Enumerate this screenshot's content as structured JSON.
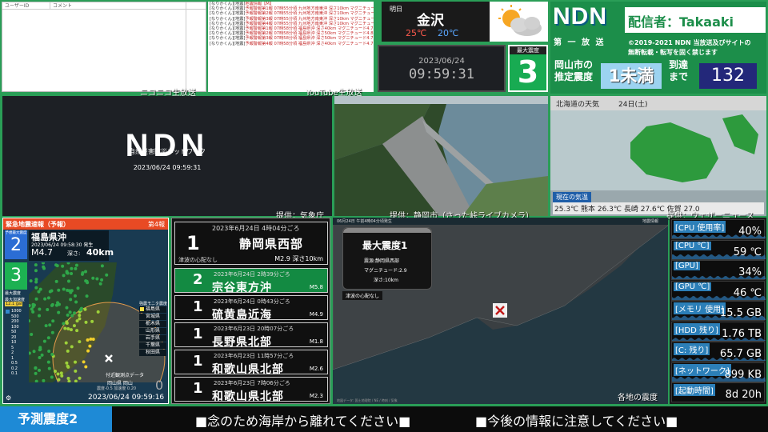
{
  "comments": {
    "col_user": "ユーザーID",
    "col_comment": "コメント"
  },
  "log": [
    [
      "[なりかくん][地震]",
      "地震情報【M】"
    ],
    [
      "[なりかくん][地震]",
      "予報警報第1報 07時55分頃 九州地方南東沖 深さ10km マグニチュード3.5 予想最大震度1"
    ],
    [
      "[なりかくん][地震]",
      "予報警報第2報 07時55分頃 九州地方南東沖 深さ10km マグニチュード3.5 予想震度1"
    ],
    [
      "[なりかくん][地震]",
      "予報警報第3報 07時55分頃 九州地方南東沖 深さ10km マグニチュード3.5 予想最大震度1"
    ],
    [
      "[なりかくん][地震]",
      "予報警報第4報 07時55分頃 九州地方南東沖 深さ10km マグニチュード3.5 予想震度1"
    ],
    [
      "[なりかくん][地震]",
      "予報警報第1報 07時58分頃 福島県沖 深さ40km マグニチュード4.7 予想最大震度2"
    ],
    [
      "[なりかくん][地震]",
      "予報警報第2報 07時58分頃 福島県沖 深さ50km マグニチュード4.8 予想最大震度2"
    ],
    [
      "[なりかくん][地震]",
      "予報警報第3報 07時58分頃 福島県沖 深さ50km マグニチュード4.7 予想最大震度2"
    ],
    [
      "[なりかくん][地震]",
      "予報警報第4報 07時58分頃 福島県沖 深さ40km マグニチュード4.7 予想最大震度2"
    ]
  ],
  "stream_labels": {
    "niconico": "ニコニコ生放送",
    "youtube": "YouTube生放送"
  },
  "weather": {
    "day": "明日",
    "city": "金沢",
    "high": "25℃",
    "low": "20℃"
  },
  "clock": {
    "date": "2023/06/24",
    "time": "09:59:31"
  },
  "max_int": {
    "label": "最大震度",
    "value": "3"
  },
  "ndn": {
    "logo": "NDN",
    "broadcaster": "配信者：Takaaki",
    "sub": "第 一 放 送",
    "copyright": "©2019-2021 NDN 当放送及びサイトの",
    "copyright2": "無断転載・転写を固く禁じます",
    "estimate_label": "岡山市の",
    "estimate_label2": "推定震度",
    "estimate_value": "1未満",
    "arrival_label": "到達",
    "arrival_label2": "まで",
    "arrival_value": "132"
  },
  "tele": {
    "logo": "NDN",
    "subtitle": "自然災害防災ネットワーク",
    "time": "2023/06/24 09:59:31"
  },
  "credits": {
    "jma": "提供：気象庁",
    "cam": "提供：静岡市（さった峠ライブカメラ）",
    "wn": "提供：ウェザーニュース"
  },
  "wmap": {
    "title": "北海道の天気",
    "date": "24日(土)",
    "current": "現在の気温",
    "temps": "25.3℃   熊本 26.3℃   長崎 27.6℃   佐賀 27.0"
  },
  "eew": {
    "header": "緊急地震速報（予報）",
    "report": "第4報",
    "pred_label": "予想最大震度",
    "pred_value": "2",
    "region": "福島県沖",
    "origin": "2023/06/24 09:58:30 発生",
    "mag": "M4.7",
    "depth_label": "深さ:",
    "depth": "40km",
    "obs_label": "最大震度",
    "obs_value": "3",
    "pga_label": "最大加速度",
    "pga_value": "12.1 gal",
    "stations": [
      "福島県",
      "宮城県",
      "栃木県",
      "山形県",
      "岩手県",
      "千葉県",
      "秋田県"
    ],
    "monitor_label": "強震モニタ震度",
    "near_label": "付近観測点データ",
    "near_name": "岡山県 岡山",
    "near_value": "震度-0.5 加速度 0.20",
    "near_int": "0",
    "time": "2023/06/24 09:59:16",
    "scale": [
      "1000",
      "500",
      "200",
      "100",
      "50",
      "20",
      "10",
      "5",
      "2",
      "1",
      "0.5",
      "0.2",
      "0.1"
    ]
  },
  "eqlist": [
    {
      "date": "2023年6月24日 4時04分ごろ",
      "int": "1",
      "loc": "静岡県西部",
      "mag": "M2.9 深さ10km",
      "note": "津波の心配なし"
    },
    {
      "date": "2023年6月24日 2時39分ごろ",
      "int": "2",
      "loc": "宗谷東方沖",
      "mag": "M5.8"
    },
    {
      "date": "2023年6月24日 0時43分ごろ",
      "int": "1",
      "loc": "硫黄島近海",
      "mag": "M4.9"
    },
    {
      "date": "2023年6月23日 20時07分ごろ",
      "int": "1",
      "loc": "長野県北部",
      "mag": "M1.8"
    },
    {
      "date": "2023年6月23日 11時57分ごろ",
      "int": "1",
      "loc": "和歌山県北部",
      "mag": "M2.6"
    },
    {
      "date": "2023年6月23日 7時06分ごろ",
      "int": "1",
      "loc": "和歌山県北部",
      "mag": "M2.3"
    }
  ],
  "map": {
    "header": "06月24日 午前4時04分頃発生",
    "info_title": "地震情報",
    "card_title": "最大震度1",
    "card_src": "震源:静岡県西部",
    "card_mag": "マグニチュード:2.9",
    "card_depth": "深さ:10km",
    "tsunami": "津波の心配なし",
    "footer": "各地の震度",
    "note": "地図データ: 国土地理院 / NE / 時刻 / 気象"
  },
  "stats": [
    {
      "label": "[CPU 使用率]",
      "value": "40%",
      "level": 0.4
    },
    {
      "label": "[CPU ℃]",
      "value": "59 ℃",
      "level": 0.59
    },
    {
      "label": "[GPU]",
      "value": "34%",
      "level": 0.34
    },
    {
      "label": "[GPU ℃]",
      "value": "46 ℃",
      "level": 0.46
    },
    {
      "label": "[メモリ 使用]",
      "value": "15.5 GB",
      "level": 0.5
    },
    {
      "label": "[HDD 残り]",
      "value": "1.76 TB",
      "level": 0.3
    },
    {
      "label": "[C: 残り]",
      "value": "65.7 GB",
      "level": 0.3
    },
    {
      "label": "[ネットワーク]",
      "value": "899 KB",
      "level": 0.6
    },
    {
      "label": "[起動時間]",
      "value": "8d 20h",
      "level": 0
    }
  ],
  "ticker": {
    "left": "予測震度2",
    "msg1": "■念のため海岸から離れてください■",
    "msg2": "■今後の情報に注意してください■"
  }
}
